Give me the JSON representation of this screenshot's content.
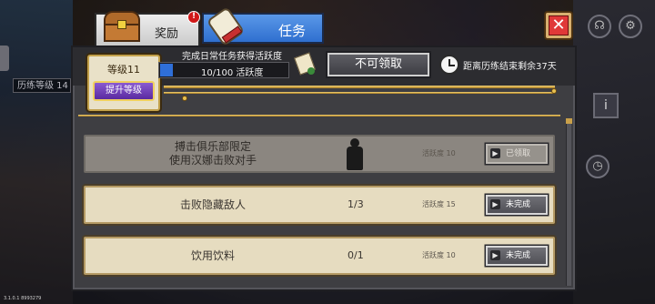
{
  "background": {
    "hud_level_text": "历练等级 14",
    "version": "3.1.0.1 8993279"
  },
  "tabs": [
    {
      "label": "奖励",
      "badge": "!",
      "active": false
    },
    {
      "label": "任务",
      "active": true
    }
  ],
  "header": {
    "level_label": "等级11",
    "upgrade_button": "提升等级",
    "hint": "完成日常任务获得活跃度",
    "progress_text": "10/100 活跃度",
    "progress_fraction": 0.1,
    "claim_button": "不可领取",
    "countdown": "距离历练结束剩余37天"
  },
  "tasks": [
    {
      "name_line1": "搏击俱乐部限定",
      "name_line2": "使用汉娜击败对手",
      "progress": "",
      "activity": "活跃度 10",
      "status": "已领取",
      "state": "done"
    },
    {
      "name_line1": "击败隐藏敌人",
      "name_line2": "",
      "progress": "1/3",
      "activity": "活跃度 15",
      "status": "未完成",
      "state": "open"
    },
    {
      "name_line1": "饮用饮料",
      "name_line2": "",
      "progress": "0/1",
      "activity": "活跃度 10",
      "status": "未完成",
      "state": "open"
    }
  ],
  "colors": {
    "active_tab": "#3a7fe0",
    "progress_fill": "#2f6fd8",
    "upgrade_purple": "#6e3fbf",
    "close_red": "#e03838",
    "gold": "#d9b45a",
    "row_parchment": "#e6dcc0",
    "row_claimed": "#8b8680"
  },
  "icons": [
    "treasure-chest-icon",
    "scroll-icon",
    "close-icon",
    "clock-icon",
    "chevron-right-icon",
    "character-silhouette-icon"
  ]
}
